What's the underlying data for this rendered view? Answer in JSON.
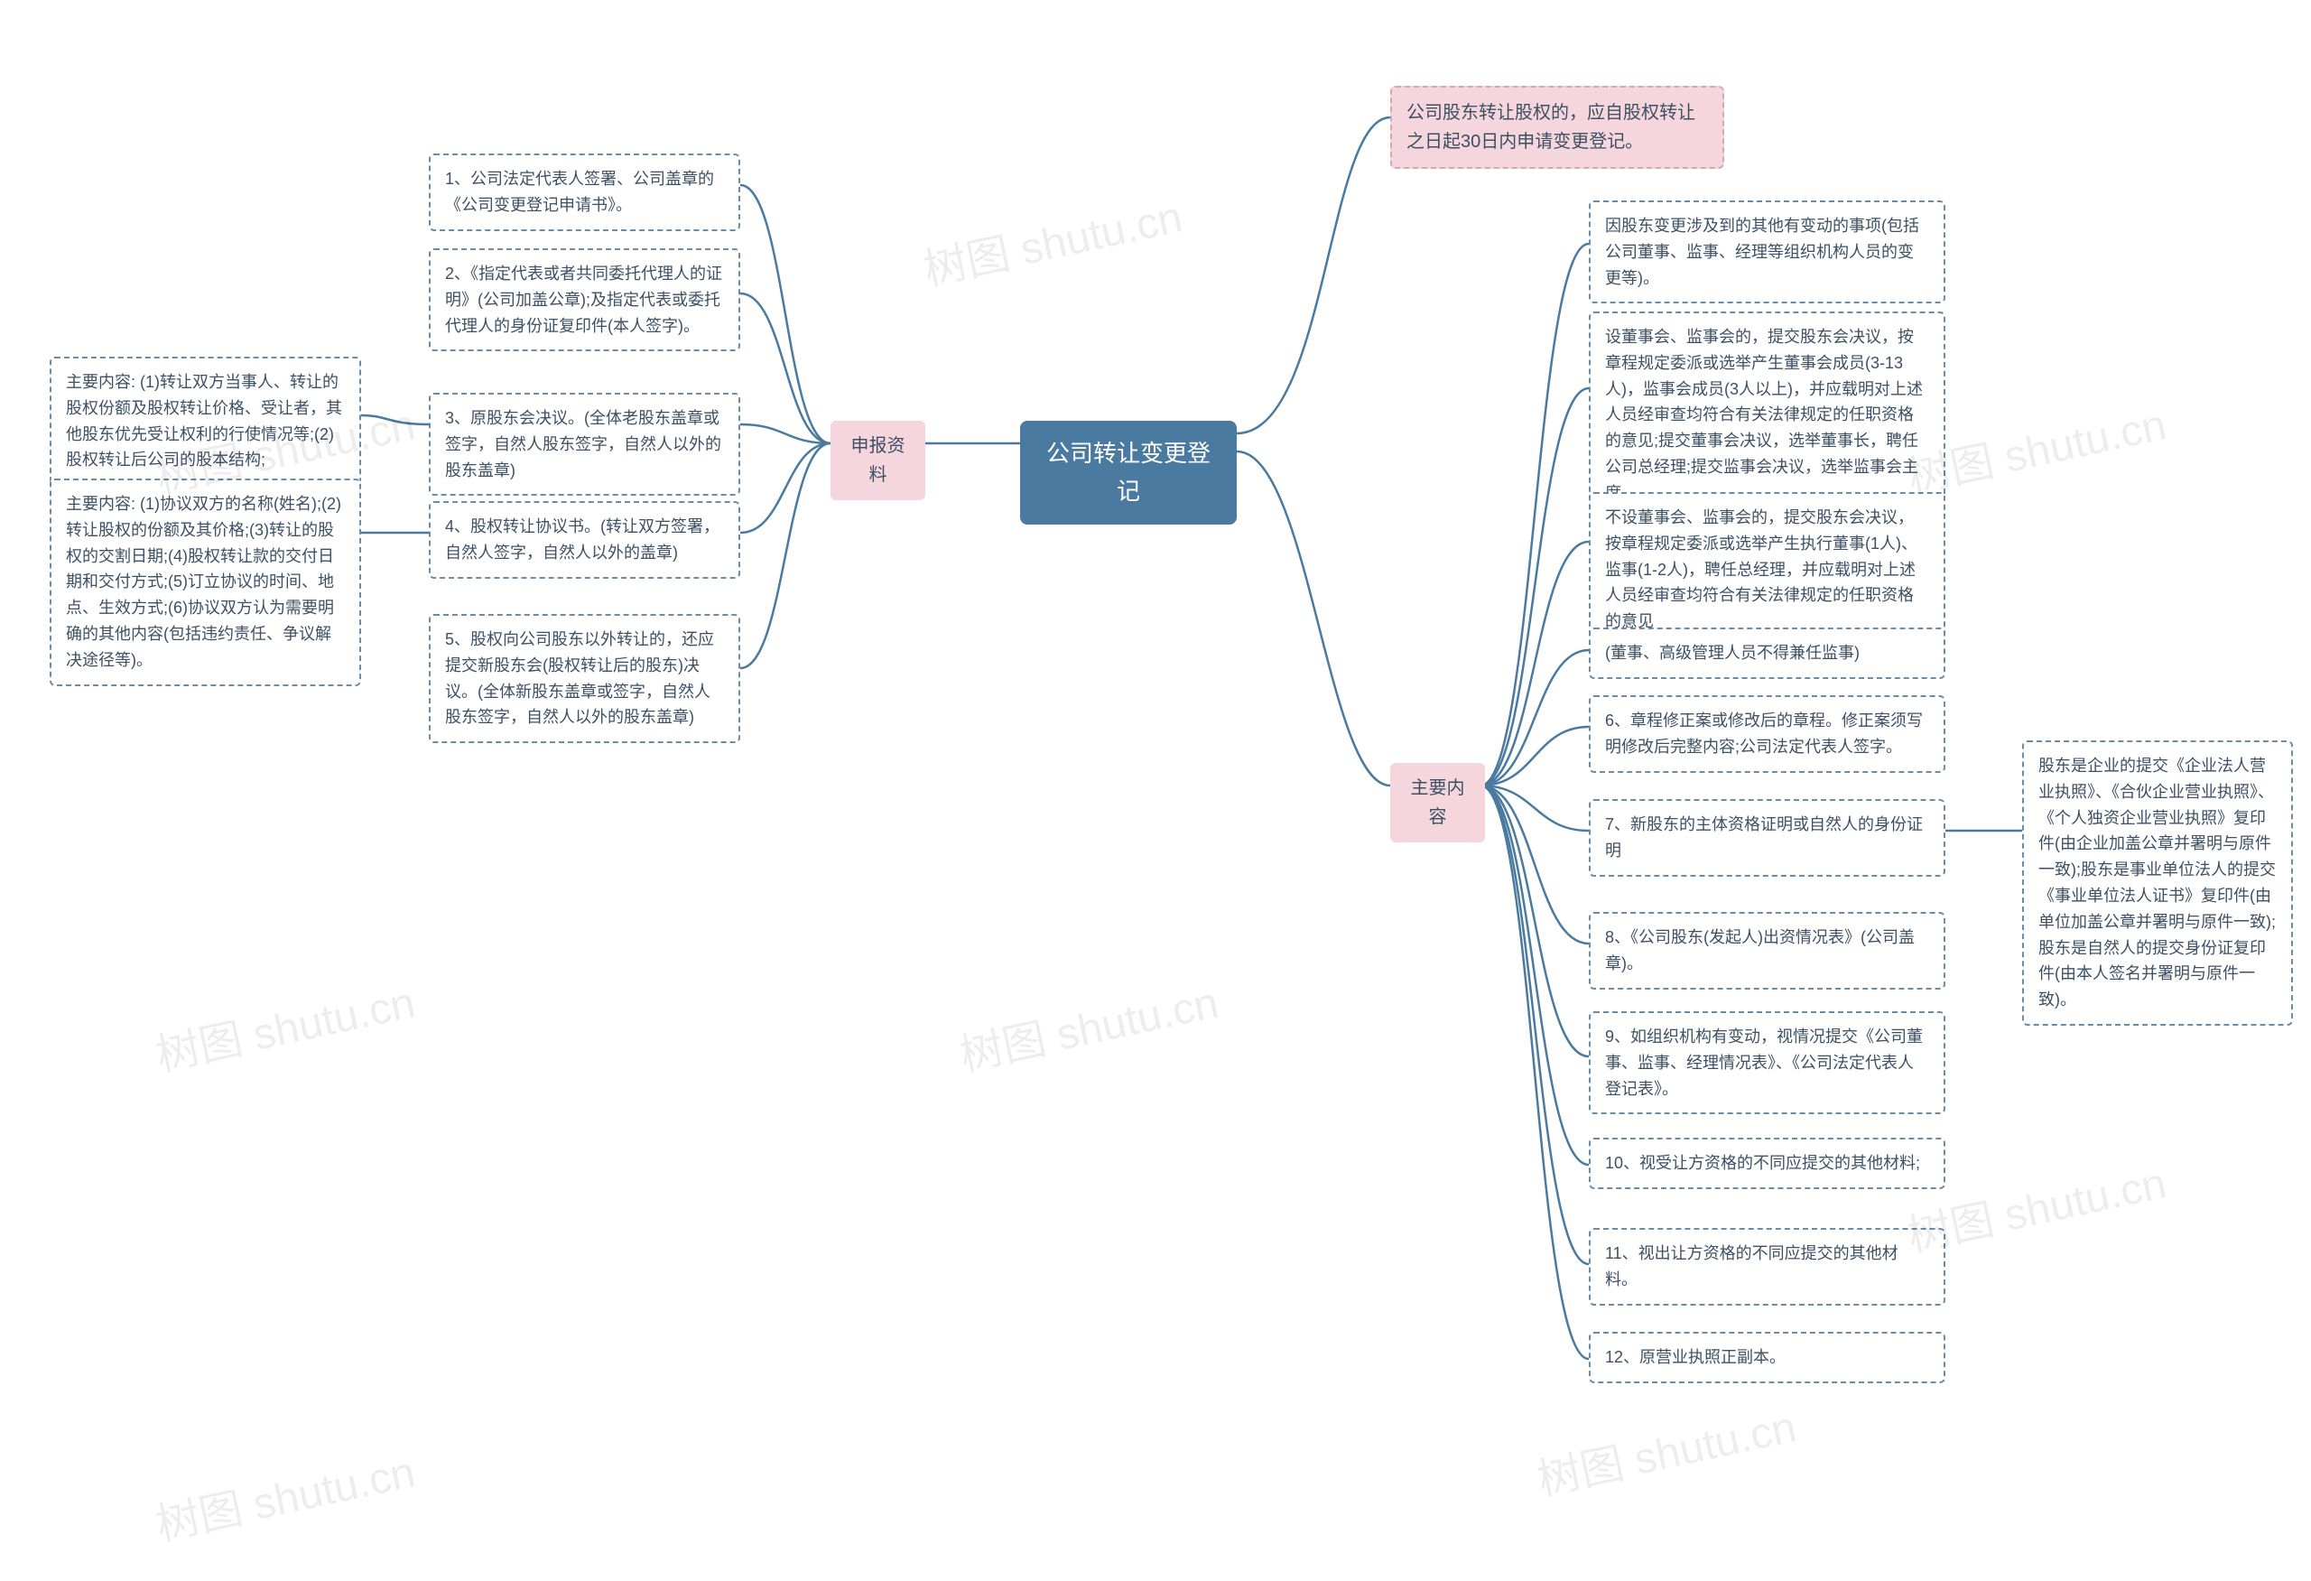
{
  "root": {
    "label": "公司转让变更登记"
  },
  "left_branch": {
    "label": "申报资料"
  },
  "right_branch": {
    "label": "主要内容"
  },
  "left_items": {
    "i1": "1、公司法定代表人签署、公司盖章的《公司变更登记申请书》。",
    "i2": "2、《指定代表或者共同委托代理人的证明》(公司加盖公章);及指定代表或委托代理人的身份证复印件(本人签字)。",
    "i3": "3、原股东会决议。(全体老股东盖章或签字，自然人股东签字，自然人以外的股东盖章)",
    "i4": "4、股权转让协议书。(转让双方签署，自然人签字，自然人以外的盖章)",
    "i5": "5、股权向公司股东以外转让的，还应提交新股东会(股权转让后的股东)决议。(全体新股东盖章或签字，自然人股东签字，自然人以外的股东盖章)"
  },
  "left_subs": {
    "s3": "主要内容: (1)转让双方当事人、转让的股权份额及股权转让价格、受让者，其他股东优先受让权利的行使情况等;(2)股权转让后公司的股本结构;",
    "s4": "主要内容: (1)协议双方的名称(姓名);(2)转让股权的份额及其价格;(3)转让的股权的交割日期;(4)股权转让款的交付日期和交付方式;(5)订立协议的时间、地点、生效方式;(6)协议双方认为需要明确的其他内容(包括违约责任、争议解决途径等)。"
  },
  "right_top": {
    "label": "公司股东转让股权的，应自股权转让之日起30日内申请变更登记。"
  },
  "right_items": {
    "r1": "因股东变更涉及到的其他有变动的事项(包括公司董事、监事、经理等组织机构人员的变更等)。",
    "r2": "设董事会、监事会的，提交股东会决议，按章程规定委派或选举产生董事会成员(3-13人)，监事会成员(3人以上)，并应载明对上述人员经审查均符合有关法律规定的任职资格的意见;提交董事会决议，选举董事长，聘任公司总经理;提交监事会决议，选举监事会主席。",
    "r3": "不设董事会、监事会的，提交股东会决议，按章程规定委派或选举产生执行董事(1人)、监事(1-2人)，聘任总经理，并应载明对上述人员经审查均符合有关法律规定的任职资格的意见",
    "r4": "(董事、高级管理人员不得兼任监事)",
    "r5": "6、章程修正案或修改后的章程。修正案须写明修改后完整内容;公司法定代表人签字。",
    "r6": "7、新股东的主体资格证明或自然人的身份证明",
    "r7": "8、《公司股东(发起人)出资情况表》(公司盖章)。",
    "r8": "9、如组织机构有变动，视情况提交《公司董事、监事、经理情况表》、《公司法定代表人登记表》。",
    "r9": "10、视受让方资格的不同应提交的其他材料;",
    "r10": "11、视出让方资格的不同应提交的其他材料。",
    "r11": "12、原营业执照正副本。"
  },
  "right_sub": {
    "s6": "股东是企业的提交《企业法人营业执照》、《合伙企业营业执照》、《个人独资企业营业执照》复印件(由企业加盖公章并署明与原件一致);股东是事业单位法人的提交《事业单位法人证书》复印件(由单位加盖公章并署明与原件一致);股东是自然人的提交身份证复印件(由本人签名并署明与原件一致)。"
  },
  "watermark": "树图 shutu.cn"
}
